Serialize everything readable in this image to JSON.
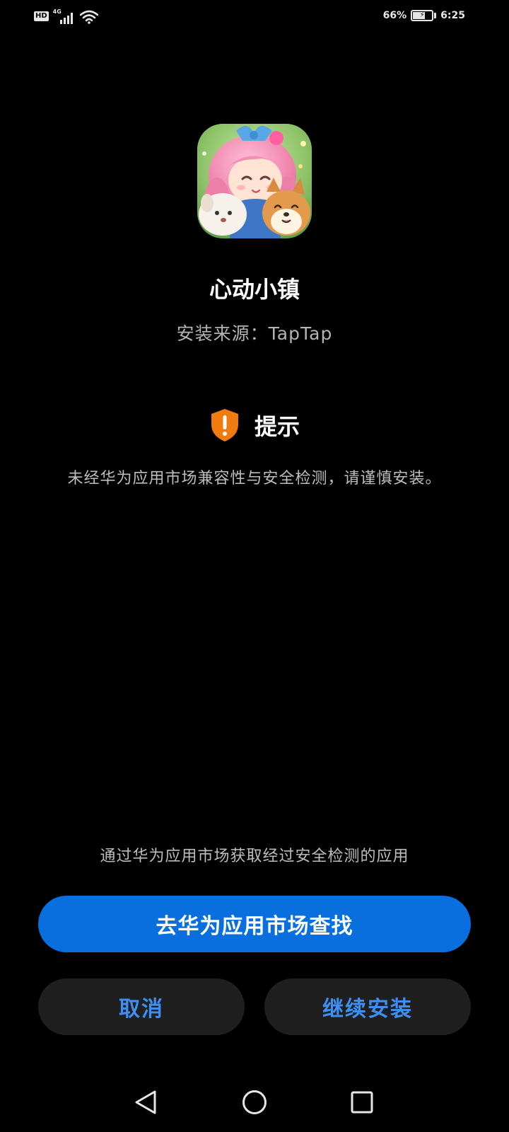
{
  "status_bar": {
    "hd": "HD",
    "network": "4G",
    "battery_text": "66%",
    "battery_level": 0.66,
    "time": "6:25",
    "icons": [
      "hd-badge",
      "signal-icon",
      "wifi-icon",
      "battery-charging-icon"
    ]
  },
  "app": {
    "name": "心动小镇",
    "source": "安装来源：TapTap",
    "icon": "app-icon"
  },
  "notice": {
    "icon": "shield-alert-icon",
    "title": "提示",
    "text": "未经华为应用市场兼容性与安全检测，请谨慎安装。"
  },
  "actions": {
    "hint": "通过华为应用市场获取经过安全检测的应用",
    "market_button": "去华为应用市场查找",
    "cancel_button": "取消",
    "continue_button": "继续安装"
  },
  "nav": {
    "icons": [
      "back-icon",
      "home-icon",
      "recent-apps-icon"
    ]
  },
  "colors": {
    "background": "#000000",
    "primary_button": "#0a6fde",
    "secondary_button": "#1f1f1f",
    "accent_text": "#3d8ff2",
    "warning": "#f07c0f"
  }
}
